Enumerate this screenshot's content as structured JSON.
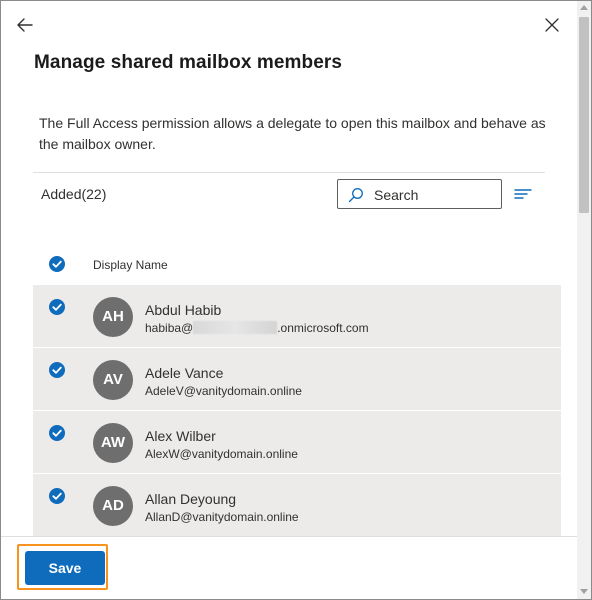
{
  "panel": {
    "title": "Manage shared mailbox members",
    "description": "The Full Access permission allows a delegate to open this mailbox and behave as the mailbox owner."
  },
  "toolbar": {
    "added_label": "Added(22)",
    "search_label": "Search",
    "search_icon": "search-icon",
    "filter_icon": "filter-lines-icon"
  },
  "table": {
    "column_display_name": "Display Name",
    "rows": [
      {
        "initials": "AH",
        "name": "Abdul Habib",
        "email_prefix": "habiba@",
        "email_suffix": ".onmicrosoft.com"
      },
      {
        "initials": "AV",
        "name": "Adele Vance",
        "email": "AdeleV@vanitydomain.online"
      },
      {
        "initials": "AW",
        "name": "Alex Wilber",
        "email": "AlexW@vanitydomain.online"
      },
      {
        "initials": "AD",
        "name": "Allan Deyoung",
        "email": "AllanD@vanitydomain.online"
      }
    ]
  },
  "footer": {
    "save_label": "Save"
  },
  "colors": {
    "accent": "#0f6cbd",
    "row_bg": "#edebe9",
    "avatar": "#6e6e6e",
    "highlight": "#f7931e"
  }
}
